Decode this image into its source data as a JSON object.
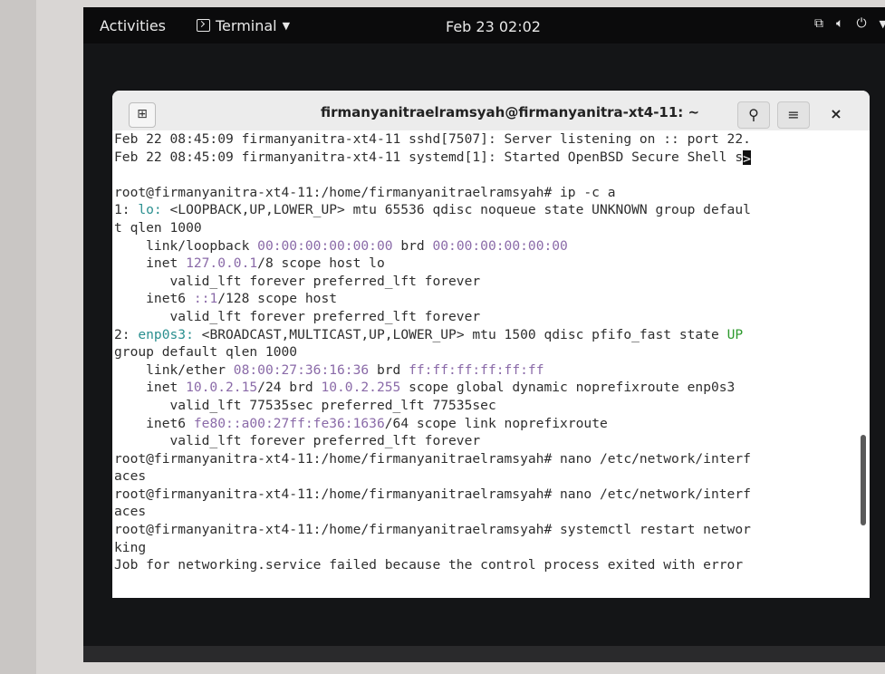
{
  "top_bar": {
    "activities": "Activities",
    "app_name": "Terminal",
    "clock": "Feb 23  02:02",
    "status_icons": [
      "network-icon",
      "volume-icon",
      "power-icon"
    ]
  },
  "window": {
    "title": "firmanyanitraelramsyah@firmanyanitra-xt4-11: ~"
  },
  "terminal": {
    "lines": [
      {
        "parts": [
          {
            "t": "Feb 22 08:45:09 firmanyanitra-xt4-11 sshd[7507]: Server listening on :: port 22."
          }
        ]
      },
      {
        "parts": [
          {
            "t": "Feb 22 08:45:09 firmanyanitra-xt4-11 systemd[1]: Started OpenBSD Secure Shell s"
          },
          {
            "t": ">",
            "cls": "cursor"
          }
        ]
      },
      {
        "parts": [
          {
            "t": ""
          }
        ]
      },
      {
        "parts": [
          {
            "t": "root@firmanyanitra-xt4-11:/home/firmanyanitraelramsyah# ip -c a"
          }
        ]
      },
      {
        "parts": [
          {
            "t": "1: "
          },
          {
            "t": "lo:",
            "cls": "c-teal"
          },
          {
            "t": " <LOOPBACK,UP,LOWER_UP> mtu 65536 qdisc noqueue state UNKNOWN group defaul"
          }
        ]
      },
      {
        "parts": [
          {
            "t": "t qlen 1000"
          }
        ]
      },
      {
        "parts": [
          {
            "t": "    link/loopback "
          },
          {
            "t": "00:00:00:00:00:00",
            "cls": "c-purple"
          },
          {
            "t": " brd "
          },
          {
            "t": "00:00:00:00:00:00",
            "cls": "c-purple"
          }
        ]
      },
      {
        "parts": [
          {
            "t": "    inet "
          },
          {
            "t": "127.0.0.1",
            "cls": "c-purple"
          },
          {
            "t": "/8 scope host lo"
          }
        ]
      },
      {
        "parts": [
          {
            "t": "       valid_lft forever preferred_lft forever"
          }
        ]
      },
      {
        "parts": [
          {
            "t": "    inet6 "
          },
          {
            "t": "::1",
            "cls": "c-purple"
          },
          {
            "t": "/128 scope host"
          }
        ]
      },
      {
        "parts": [
          {
            "t": "       valid_lft forever preferred_lft forever"
          }
        ]
      },
      {
        "parts": [
          {
            "t": "2: "
          },
          {
            "t": "enp0s3:",
            "cls": "c-teal"
          },
          {
            "t": " <BROADCAST,MULTICAST,UP,LOWER_UP> mtu 1500 qdisc pfifo_fast state "
          },
          {
            "t": "UP",
            "cls": "c-green"
          }
        ]
      },
      {
        "parts": [
          {
            "t": "group default qlen 1000"
          }
        ]
      },
      {
        "parts": [
          {
            "t": "    link/ether "
          },
          {
            "t": "08:00:27:36:16:36",
            "cls": "c-purple"
          },
          {
            "t": " brd "
          },
          {
            "t": "ff:ff:ff:ff:ff:ff",
            "cls": "c-purple"
          }
        ]
      },
      {
        "parts": [
          {
            "t": "    inet "
          },
          {
            "t": "10.0.2.15",
            "cls": "c-purple"
          },
          {
            "t": "/24 brd "
          },
          {
            "t": "10.0.2.255",
            "cls": "c-purple"
          },
          {
            "t": " scope global dynamic noprefixroute enp0s3"
          }
        ]
      },
      {
        "parts": [
          {
            "t": "       valid_lft 77535sec preferred_lft 77535sec"
          }
        ]
      },
      {
        "parts": [
          {
            "t": "    inet6 "
          },
          {
            "t": "fe80::a00:27ff:fe36:1636",
            "cls": "c-purple"
          },
          {
            "t": "/64 scope link noprefixroute"
          }
        ]
      },
      {
        "parts": [
          {
            "t": "       valid_lft forever preferred_lft forever"
          }
        ]
      },
      {
        "parts": [
          {
            "t": "root@firmanyanitra-xt4-11:/home/firmanyanitraelramsyah# nano /etc/network/interf"
          }
        ]
      },
      {
        "parts": [
          {
            "t": "aces"
          }
        ]
      },
      {
        "parts": [
          {
            "t": "root@firmanyanitra-xt4-11:/home/firmanyanitraelramsyah# nano /etc/network/interf"
          }
        ]
      },
      {
        "parts": [
          {
            "t": "aces"
          }
        ]
      },
      {
        "parts": [
          {
            "t": "root@firmanyanitra-xt4-11:/home/firmanyanitraelramsyah# systemctl restart networ"
          }
        ]
      },
      {
        "parts": [
          {
            "t": "king"
          }
        ]
      },
      {
        "parts": [
          {
            "t": "Job for networking.service failed because the control process exited with error"
          }
        ]
      }
    ]
  }
}
